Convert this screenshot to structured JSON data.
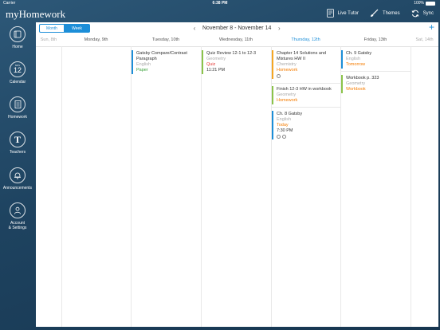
{
  "status_bar": {
    "carrier": "Carrier",
    "time": "6:38 PM",
    "battery": "100%"
  },
  "app": {
    "title": "myHomework"
  },
  "top_actions": [
    {
      "label": "Live Tutor",
      "icon": "tutor-icon"
    },
    {
      "label": "Themes",
      "icon": "brush-icon"
    },
    {
      "label": "Sync",
      "icon": "sync-icon"
    }
  ],
  "sidebar": {
    "items": [
      {
        "label": "Home",
        "icon": "home-icon"
      },
      {
        "label": "Calendar",
        "icon": "calendar-icon",
        "day": "12",
        "month": "NOV"
      },
      {
        "label": "Homework",
        "icon": "homework-icon"
      },
      {
        "label": "Teachers",
        "icon": "teacher-icon",
        "glyph": "T"
      },
      {
        "label": "Announcements",
        "icon": "bell-icon"
      },
      {
        "label": "Account\n& Settings",
        "icon": "person-icon"
      }
    ]
  },
  "view_toggle": {
    "month": "Month",
    "week": "Week",
    "selected": "Week"
  },
  "range": {
    "label": "November 8 - November 14"
  },
  "days": [
    {
      "label": "Sun, 8th",
      "state": "muted"
    },
    {
      "label": "Monday, 9th",
      "state": "normal"
    },
    {
      "label": "Tuesday, 10th",
      "state": "normal"
    },
    {
      "label": "Wednesday, 11th",
      "state": "normal"
    },
    {
      "label": "Thursday, 12th",
      "state": "today"
    },
    {
      "label": "Friday, 13th",
      "state": "normal"
    },
    {
      "label": "Sat, 14th",
      "state": "muted"
    }
  ],
  "assignments": {
    "tue_1": {
      "title": "Gatsby Compare/Contrast Paragraph",
      "subject": "English",
      "status": "Paper",
      "status_color": "#3aa13a",
      "color": "#1c8ed8"
    },
    "wed_1": {
      "title": "Quiz Review 12-1 to 12-3",
      "subject": "Geometry",
      "status": "Quiz",
      "status_color": "#e53935",
      "time": "11:21 PM",
      "color": "#8bc34a"
    },
    "thu_1": {
      "title": "Chapter 14 Solutions and Mixtures HW II",
      "subject": "Chemistry",
      "status": "Homework",
      "status_color": "#f57c00",
      "color": "#f5a623"
    },
    "thu_2": {
      "title": "Finish 12-3 HW in workbook",
      "subject": "Geometry",
      "status": "Homework",
      "status_color": "#f57c00",
      "color": "#8bc34a"
    },
    "thu_3": {
      "title": "Ch. 8 Gatsby",
      "subject": "English",
      "status": "Today",
      "status_color": "#f57c00",
      "time": "7:30 PM",
      "color": "#1c8ed8"
    },
    "fri_1": {
      "title": "Ch. 9 Gatsby",
      "subject": "English",
      "status": "Tomorrow",
      "status_color": "#f57c00",
      "color": "#1c8ed8"
    },
    "fri_2": {
      "title": "Workbook p. 323",
      "subject": "Geometry",
      "status": "Workbook",
      "status_color": "#f57c00",
      "color": "#8bc34a"
    }
  },
  "colors": {
    "accent": "#1c8ed8",
    "today": "#1c8ed8"
  }
}
